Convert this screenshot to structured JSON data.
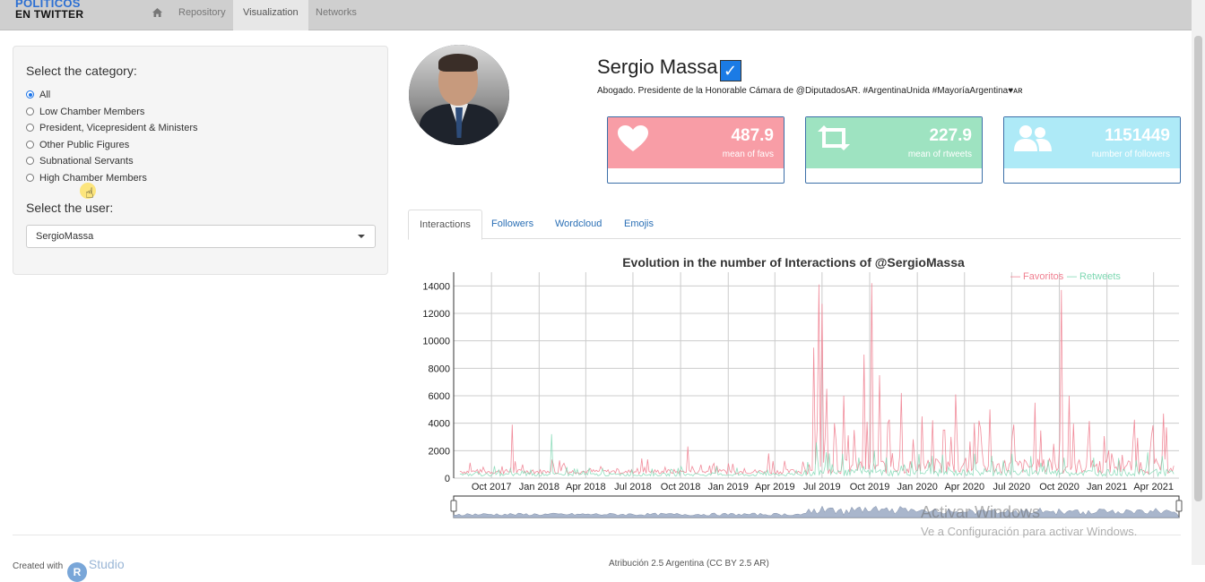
{
  "brand": {
    "line1": "POLITICOS",
    "line2": "EN TWITTER"
  },
  "nav": {
    "home_icon": "home-icon",
    "repository": "Repository",
    "visualization": "Visualization",
    "networks": "Networks"
  },
  "sidebar": {
    "category_heading": "Select the category:",
    "categories": [
      {
        "label": "All",
        "selected": true
      },
      {
        "label": "Low Chamber Members",
        "selected": false
      },
      {
        "label": "President, Vicepresident & Ministers",
        "selected": false
      },
      {
        "label": "Other Public Figures",
        "selected": false
      },
      {
        "label": "Subnational Servants",
        "selected": false
      },
      {
        "label": "High Chamber Members",
        "selected": false
      }
    ],
    "user_heading": "Select the user:",
    "user_selected": "SergioMassa"
  },
  "profile": {
    "name": "Sergio Massa",
    "verified_mark": "✓",
    "bio": "Abogado. Presidente de la Honorable Cámara de @DiputadosAR. #ArgentinaUnida #MayoríaArgentina♥ᴀʀ"
  },
  "stats": [
    {
      "value": "487.9",
      "label": "mean of favs",
      "icon": "heart-icon",
      "color": "#f89da6"
    },
    {
      "value": "227.9",
      "label": "mean of rtweets",
      "icon": "retweet-icon",
      "color": "#9ee3c1"
    },
    {
      "value": "1151449",
      "label": "number of followers",
      "icon": "users-icon",
      "color": "#aeeaf7"
    }
  ],
  "tabs": [
    "Interactions",
    "Followers",
    "Wordcloud",
    "Emojis"
  ],
  "chart_data": {
    "type": "line",
    "title": "Evolution in the number of Interactions of @SergioMassa",
    "ylim": [
      0,
      15000
    ],
    "yticks": [
      0,
      2000,
      4000,
      6000,
      8000,
      10000,
      12000,
      14000
    ],
    "xticks": [
      "Oct 2017",
      "Jan 2018",
      "Apr 2018",
      "Jul 2018",
      "Oct 2018",
      "Jan 2019",
      "Apr 2019",
      "Jul 2019",
      "Oct 2019",
      "Jan 2020",
      "Apr 2020",
      "Jul 2020",
      "Oct 2020",
      "Jan 2021",
      "Apr 2021"
    ],
    "legend_position": "top-right",
    "grid": true,
    "series": [
      {
        "name": "Favoritos",
        "color": "#f07f90",
        "points": [
          [
            "2017-08-01",
            500
          ],
          [
            "2017-09-15",
            800
          ],
          [
            "2017-11-10",
            3900
          ],
          [
            "2017-12-20",
            600
          ],
          [
            "2018-02-15",
            900
          ],
          [
            "2018-04-10",
            700
          ],
          [
            "2018-06-20",
            400
          ],
          [
            "2018-09-01",
            800
          ],
          [
            "2018-10-15",
            2300
          ],
          [
            "2018-12-10",
            900
          ],
          [
            "2019-02-01",
            700
          ],
          [
            "2019-03-20",
            1800
          ],
          [
            "2019-05-01",
            600
          ],
          [
            "2019-05-25",
            1200
          ],
          [
            "2019-06-15",
            9500
          ],
          [
            "2019-06-25",
            14100
          ],
          [
            "2019-07-01",
            12700
          ],
          [
            "2019-07-10",
            6500
          ],
          [
            "2019-07-25",
            4000
          ],
          [
            "2019-08-12",
            6000
          ],
          [
            "2019-09-01",
            3500
          ],
          [
            "2019-09-20",
            9000
          ],
          [
            "2019-10-05",
            14200
          ],
          [
            "2019-10-20",
            7500
          ],
          [
            "2019-11-05",
            4000
          ],
          [
            "2019-12-01",
            6200
          ],
          [
            "2020-01-10",
            4500
          ],
          [
            "2020-02-20",
            3500
          ],
          [
            "2020-03-15",
            6100
          ],
          [
            "2020-04-20",
            4000
          ],
          [
            "2020-05-20",
            5000
          ],
          [
            "2020-07-05",
            3900
          ],
          [
            "2020-08-15",
            5500
          ],
          [
            "2020-09-20",
            2500
          ],
          [
            "2020-10-05",
            13700
          ],
          [
            "2020-10-20",
            6000
          ],
          [
            "2020-11-25",
            2500
          ],
          [
            "2021-01-10",
            1800
          ],
          [
            "2021-02-20",
            2600
          ],
          [
            "2021-03-25",
            1800
          ],
          [
            "2021-04-20",
            4700
          ],
          [
            "2021-05-10",
            900
          ]
        ]
      },
      {
        "name": "Retweets",
        "color": "#7fd8b3",
        "points": [
          [
            "2017-08-01",
            300
          ],
          [
            "2017-10-15",
            600
          ],
          [
            "2017-12-10",
            400
          ],
          [
            "2018-01-25",
            3200
          ],
          [
            "2018-03-10",
            700
          ],
          [
            "2018-06-01",
            300
          ],
          [
            "2018-09-15",
            600
          ],
          [
            "2018-12-01",
            400
          ],
          [
            "2019-03-01",
            500
          ],
          [
            "2019-06-20",
            2600
          ],
          [
            "2019-07-15",
            1800
          ],
          [
            "2019-09-10",
            1500
          ],
          [
            "2019-10-10",
            2000
          ],
          [
            "2019-12-01",
            900
          ],
          [
            "2020-03-01",
            800
          ],
          [
            "2020-06-01",
            700
          ],
          [
            "2020-09-01",
            900
          ],
          [
            "2020-10-10",
            1500
          ],
          [
            "2021-01-01",
            600
          ],
          [
            "2021-04-01",
            500
          ],
          [
            "2021-05-10",
            300
          ]
        ]
      }
    ]
  },
  "footer": {
    "created_with": "Created with",
    "rs_mark": "R",
    "studio_label": "Studio",
    "license": "Atribución 2.5 Argentina (CC BY 2.5 AR)"
  },
  "watermark": {
    "line1": "Activar Windows",
    "line2": "Ve a Configuración para activar Windows."
  }
}
